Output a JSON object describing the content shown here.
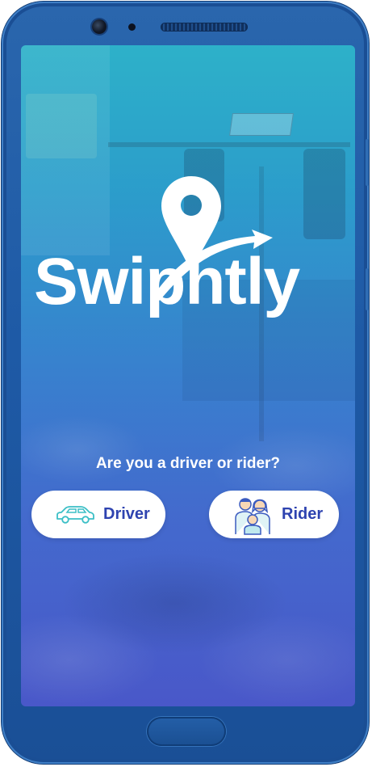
{
  "app": {
    "name": "Swiphtly"
  },
  "prompt": {
    "question": "Are you a driver or rider?"
  },
  "choices": [
    {
      "label": "Driver",
      "icon": "car-icon"
    },
    {
      "label": "Rider",
      "icon": "family-icon"
    }
  ],
  "colors": {
    "accent": "#2e43b0",
    "button_bg": "#ffffff",
    "phone_frame": "#1e5aa6",
    "screen_top": "#2fb0c9",
    "screen_bottom": "#4e57c9",
    "icon_teal": "#3bbfc6"
  }
}
